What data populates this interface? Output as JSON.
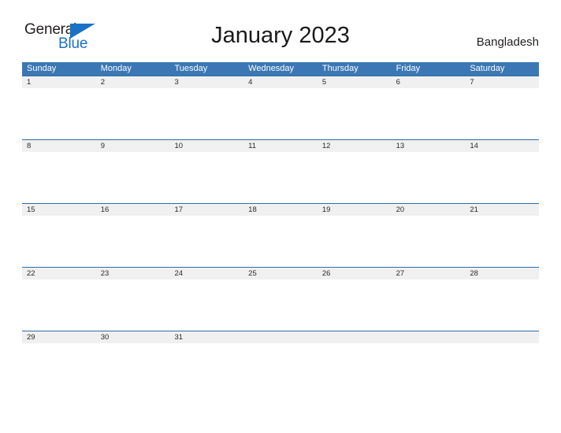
{
  "brand": {
    "name_part1": "General",
    "name_part2": "Blue",
    "flag_icon": "blue-triangle-flag-icon",
    "accent_color": "#1a72c4"
  },
  "header": {
    "title": "January 2023",
    "month": "January",
    "year": "2023",
    "country": "Bangladesh"
  },
  "colors": {
    "header_blue": "#3b77b5",
    "row_border_blue": "#2e6da4",
    "date_band_gray": "#f0f0f0",
    "page_background": "#ffffff",
    "text_dark": "#231f20"
  },
  "calendar": {
    "weekdays": [
      "Sunday",
      "Monday",
      "Tuesday",
      "Wednesday",
      "Thursday",
      "Friday",
      "Saturday"
    ],
    "weeks": [
      [
        "1",
        "2",
        "3",
        "4",
        "5",
        "6",
        "7"
      ],
      [
        "8",
        "9",
        "10",
        "11",
        "12",
        "13",
        "14"
      ],
      [
        "15",
        "16",
        "17",
        "18",
        "19",
        "20",
        "21"
      ],
      [
        "22",
        "23",
        "24",
        "25",
        "26",
        "27",
        "28"
      ],
      [
        "29",
        "30",
        "31",
        "",
        "",
        "",
        ""
      ]
    ]
  }
}
